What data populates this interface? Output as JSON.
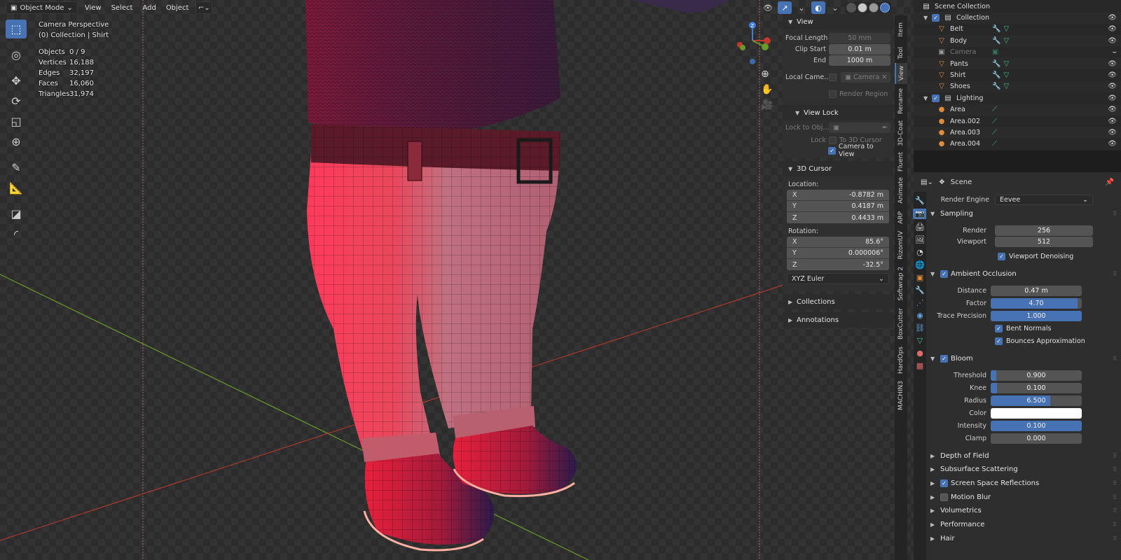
{
  "header": {
    "mode": "Object Mode",
    "menus": [
      "View",
      "Select",
      "Add",
      "Object"
    ]
  },
  "viewport": {
    "view_name": "Camera Perspective",
    "active": "(0) Collection | Shirt",
    "stats": [
      {
        "label": "Objects",
        "value": "0 / 9"
      },
      {
        "label": "Vertices",
        "value": "16,188"
      },
      {
        "label": "Edges",
        "value": "32,197"
      },
      {
        "label": "Faces",
        "value": "16,060"
      },
      {
        "label": "Triangles",
        "value": "31,974"
      }
    ]
  },
  "npanel": {
    "view_title": "View",
    "focal_length_label": "Focal Length",
    "focal_length": "50 mm",
    "clip_start_label": "Clip Start",
    "clip_start": "0.01 m",
    "end_label": "End",
    "end": "1000 m",
    "local_camera_label": "Local Came...",
    "local_camera_value": "Camera",
    "render_region_label": "Render Region",
    "view_lock_title": "View Lock",
    "lock_to_obj_label": "Lock to Obj...",
    "lock_label": "Lock",
    "to_3d_cursor_label": "To 3D Cursor",
    "camera_to_view_label": "Camera to View",
    "cursor_title": "3D Cursor",
    "location_label": "Location:",
    "loc_x": "-0.8782 m",
    "loc_y": "0.4187 m",
    "loc_z": "0.4433 m",
    "rotation_label": "Rotation:",
    "rot_x": "85.6°",
    "rot_y": "0.000006°",
    "rot_z": "-32.5°",
    "rotation_mode": "XYZ Euler",
    "collections_title": "Collections",
    "annotations_title": "Annotations",
    "axis_x": "X",
    "axis_y": "Y",
    "axis_z": "Z"
  },
  "vtabs": [
    "Item",
    "Tool",
    "View",
    "Rename",
    "3D-Coat",
    "Fluent",
    "Animate",
    "ARP",
    "RizomUV",
    "Softwrap 2",
    "BoxCutter",
    "HardOps",
    "MACHIN3"
  ],
  "outliner": {
    "root": "Scene Collection",
    "items": [
      {
        "name": "Collection",
        "kind": "collection",
        "depth": 1
      },
      {
        "name": "Belt",
        "kind": "mesh",
        "depth": 2
      },
      {
        "name": "Body",
        "kind": "mesh",
        "depth": 2
      },
      {
        "name": "Camera",
        "kind": "camera",
        "depth": 2
      },
      {
        "name": "Pants",
        "kind": "mesh",
        "depth": 2
      },
      {
        "name": "Shirt",
        "kind": "mesh",
        "depth": 2
      },
      {
        "name": "Shoes",
        "kind": "mesh",
        "depth": 2
      },
      {
        "name": "Lighting",
        "kind": "collection",
        "depth": 1
      },
      {
        "name": "Area",
        "kind": "light",
        "depth": 2
      },
      {
        "name": "Area.002",
        "kind": "light",
        "depth": 2
      },
      {
        "name": "Area.003",
        "kind": "light",
        "depth": 2
      },
      {
        "name": "Area.004",
        "kind": "light",
        "depth": 2
      }
    ]
  },
  "properties": {
    "scene_label": "Scene",
    "render_engine_label": "Render Engine",
    "render_engine": "Eevee",
    "sampling_title": "Sampling",
    "render_label": "Render",
    "render_samples": "256",
    "viewport_label": "Viewport",
    "viewport_samples": "512",
    "viewport_denoising_label": "Viewport Denoising",
    "ao_title": "Ambient Occlusion",
    "distance_label": "Distance",
    "distance": "0.47 m",
    "factor_label": "Factor",
    "factor": "4.70",
    "factor_fill": 0.95,
    "trace_precision_label": "Trace Precision",
    "trace_precision": "1.000",
    "trace_precision_fill": 1.0,
    "bent_normals_label": "Bent Normals",
    "bounces_label": "Bounces Approximation",
    "bloom_title": "Bloom",
    "threshold_label": "Threshold",
    "threshold": "0.900",
    "threshold_fill": 0.06,
    "knee_label": "Knee",
    "knee": "0.100",
    "knee_fill": 0.07,
    "radius_label": "Radius",
    "radius": "6.500",
    "radius_fill": 0.65,
    "color_label": "Color",
    "bloom_color": "#ffffff",
    "intensity_label": "Intensity",
    "intensity": "0.100",
    "intensity_fill": 1.0,
    "clamp_label": "Clamp",
    "clamp": "0.000",
    "clamp_fill": 0.0,
    "collapsed": [
      {
        "title": "Depth of Field",
        "checkbox": null
      },
      {
        "title": "Subsurface Scattering",
        "checkbox": null
      },
      {
        "title": "Screen Space Reflections",
        "checkbox": true
      },
      {
        "title": "Motion Blur",
        "checkbox": false
      },
      {
        "title": "Volumetrics",
        "checkbox": null
      },
      {
        "title": "Performance",
        "checkbox": null
      },
      {
        "title": "Hair",
        "checkbox": null
      }
    ]
  },
  "colors": {
    "accent": "#4772b3",
    "model_red": "#e0304f",
    "x_axis": "#c0392b",
    "y_axis": "#6a9a2a"
  }
}
